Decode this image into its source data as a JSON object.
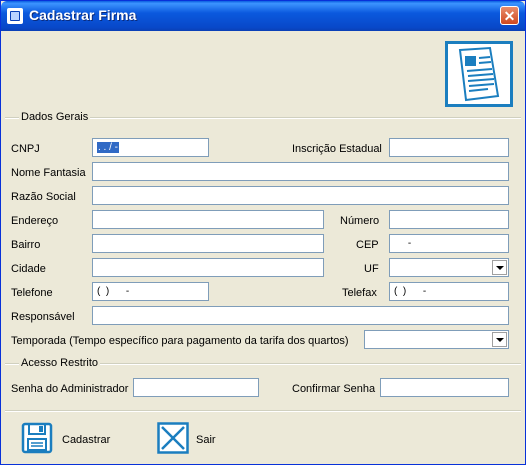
{
  "window": {
    "title": "Cadastrar Firma",
    "close_glyph": "✕"
  },
  "header_icon": "document-form-icon",
  "groups": {
    "dados_gerais": "Dados Gerais",
    "acesso_restrito": "Acesso Restrito"
  },
  "labels": {
    "cnpj": "CNPJ",
    "inscricao_estadual": "Inscrição Estadual",
    "nome_fantasia": "Nome Fantasia",
    "razao_social": "Razão Social",
    "endereco": "Endereço",
    "numero": "Número",
    "bairro": "Bairro",
    "cep": "CEP",
    "cidade": "Cidade",
    "uf": "UF",
    "telefone": "Telefone",
    "telefax": "Telefax",
    "responsavel": "Responsável",
    "temporada": "Temporada (Tempo específico para pagamento da tarifa dos quartos)",
    "senha_admin": "Senha do Administrador",
    "confirmar_senha": "Confirmar Senha"
  },
  "values": {
    "cnpj": " .   .   /   -",
    "inscricao_estadual": "",
    "nome_fantasia": "",
    "razao_social": "",
    "endereco": "",
    "numero": "",
    "bairro": "",
    "cep": "     -",
    "cidade": "",
    "uf": "",
    "telefone": "(  )      -",
    "telefax": "(  )      -",
    "responsavel": "",
    "temporada": "",
    "senha_admin": "",
    "confirmar_senha": ""
  },
  "buttons": {
    "cadastrar": "Cadastrar",
    "sair": "Sair"
  },
  "icons": {
    "cadastrar": "floppy-disk-icon",
    "sair": "close-x-icon"
  },
  "colors": {
    "titlebar": "#0b59de",
    "accent": "#1b7ebf",
    "background": "#ece9d8"
  }
}
